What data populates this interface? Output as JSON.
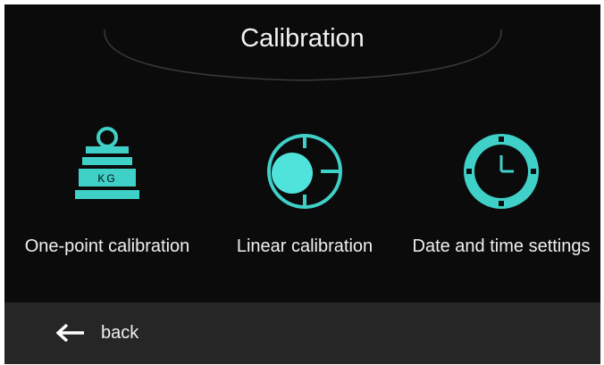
{
  "header": {
    "title": "Calibration"
  },
  "tiles": [
    {
      "label": "One-point calibration",
      "icon": "weight-kg-icon",
      "icon_text": "KG"
    },
    {
      "label": "Linear calibration",
      "icon": "linear-calibration-icon"
    },
    {
      "label": "Date and time settings",
      "icon": "clock-icon"
    }
  ],
  "footer": {
    "back_label": "back",
    "icon": "back-arrow-icon"
  },
  "colors": {
    "accent": "#3fd0c8",
    "background": "#0b0b0b",
    "footer": "#262626",
    "text": "#f0f0f0"
  }
}
